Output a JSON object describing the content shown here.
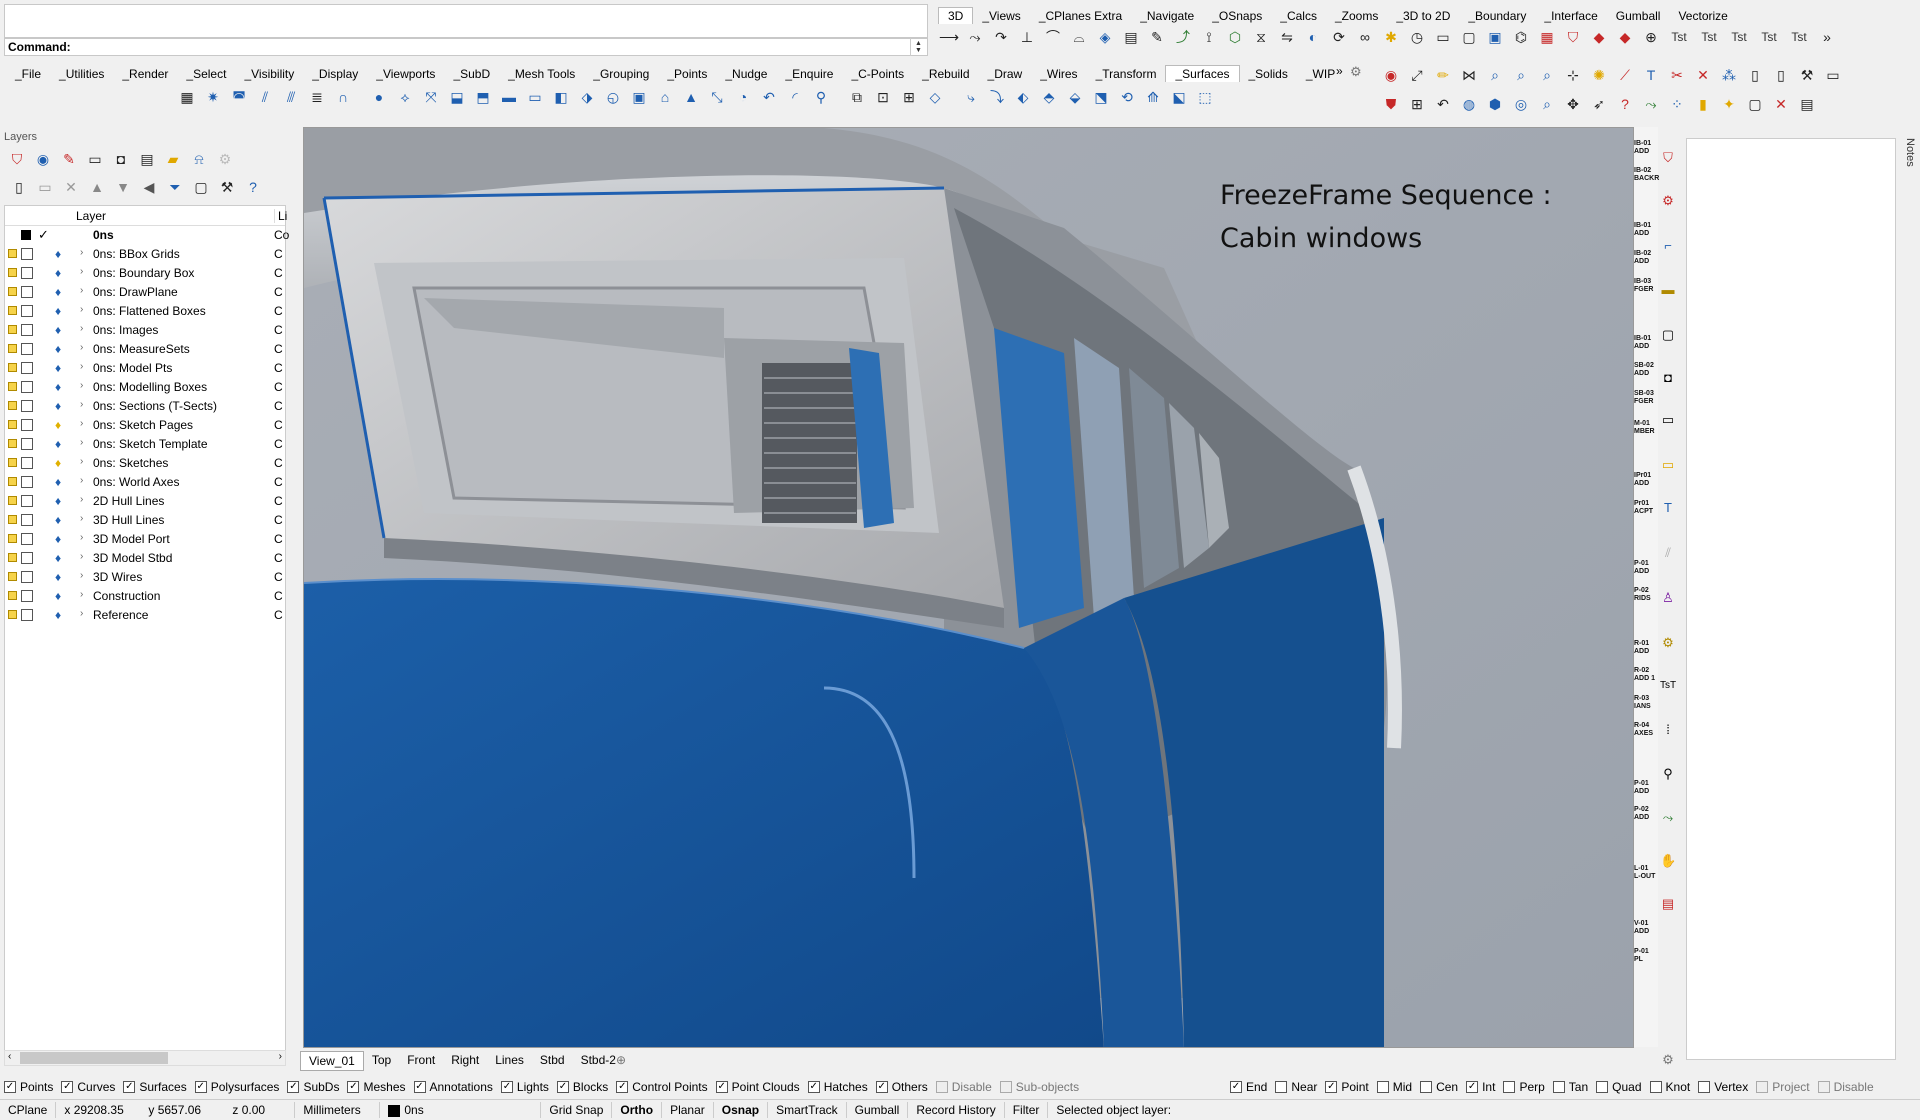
{
  "command": {
    "label": "Command:",
    "value": ""
  },
  "tabs_top": [
    "3D",
    "_Views",
    "_CPlanes Extra",
    "_Navigate",
    "_OSnaps",
    "_Calcs",
    "_Zooms",
    "_3D to 2D",
    "_Boundary",
    "_Interface",
    "Gumball",
    "Vectorize"
  ],
  "tabs_main": [
    "_File",
    "_Utilities",
    "_Render",
    "_Select",
    "_Visibility",
    "_Display",
    "_Viewports",
    "_SubD",
    "_Mesh Tools",
    "_Grouping",
    "_Points",
    "_Nudge",
    "_Enquire",
    "_C-Points",
    "_Rebuild",
    "_Draw",
    "_Wires",
    "_Transform",
    "_Surfaces",
    "_Solids",
    "_WIP"
  ],
  "tst_labels": [
    "Tst",
    "Tst",
    "Tst",
    "Tst",
    "Tst"
  ],
  "layers": {
    "title": "Layers",
    "col_layer": "Layer",
    "col_li": "Li",
    "current": "0ns",
    "rows": [
      {
        "name": "0ns: BBox Grids",
        "c": "C"
      },
      {
        "name": "0ns: Boundary Box",
        "c": "C"
      },
      {
        "name": "0ns: DrawPlane",
        "c": "C"
      },
      {
        "name": "0ns: Flattened Boxes",
        "c": "C"
      },
      {
        "name": "0ns: Images",
        "c": "C"
      },
      {
        "name": "0ns: MeasureSets",
        "c": "C"
      },
      {
        "name": "0ns: Model Pts",
        "c": "C"
      },
      {
        "name": "0ns: Modelling Boxes",
        "c": "C"
      },
      {
        "name": "0ns: Sections (T-Sects)",
        "c": "C"
      },
      {
        "name": "0ns: Sketch Pages",
        "c": "C"
      },
      {
        "name": "0ns: Sketch Template",
        "c": "C"
      },
      {
        "name": "0ns: Sketches",
        "c": "C"
      },
      {
        "name": "0ns: World Axes",
        "c": "C"
      },
      {
        "name": "2D Hull Lines",
        "c": "C"
      },
      {
        "name": "3D Hull Lines",
        "c": "C"
      },
      {
        "name": "3D Model Port",
        "c": "C"
      },
      {
        "name": "3D Model Stbd",
        "c": "C"
      },
      {
        "name": "3D Wires",
        "c": "C"
      },
      {
        "name": "Construction",
        "c": "C"
      },
      {
        "name": "Reference",
        "c": "C"
      }
    ]
  },
  "viewport": {
    "title_line1": "FreezeFrame Sequence :",
    "title_line2": "Cabin windows",
    "tabs": [
      "View_01",
      "Top",
      "Front",
      "Right",
      "Lines",
      "Stbd",
      "Stbd-2"
    ]
  },
  "right_labels": [
    "IB-01\nADD",
    "IB-02\nBACKR",
    "IB-01\nADD",
    "IB-02\nADD",
    "IB-03\nFGER",
    "IB-01\nADD",
    "SB-02\nADD",
    "SB-03\nFGER",
    "M-01\nMBER",
    "IPr01\nADD",
    "Pr01\nACPT",
    "P-01\nADD",
    "P-02\nRIDS",
    "R-01\nADD",
    "R-02\nADD 1",
    "R-03\nIANS",
    "R-04\nAXES",
    "P-01\nADD",
    "P-02\nADD",
    "L-01\nL-OUT",
    "V-01\nADD",
    "P-01\nPL"
  ],
  "notes_label": "Notes",
  "filters": [
    {
      "label": "Points",
      "on": true
    },
    {
      "label": "Curves",
      "on": true
    },
    {
      "label": "Surfaces",
      "on": true
    },
    {
      "label": "Polysurfaces",
      "on": true
    },
    {
      "label": "SubDs",
      "on": true
    },
    {
      "label": "Meshes",
      "on": true
    },
    {
      "label": "Annotations",
      "on": true
    },
    {
      "label": "Lights",
      "on": true
    },
    {
      "label": "Blocks",
      "on": true
    },
    {
      "label": "Control Points",
      "on": true
    },
    {
      "label": "Point Clouds",
      "on": true
    },
    {
      "label": "Hatches",
      "on": true
    },
    {
      "label": "Others",
      "on": true
    },
    {
      "label": "Disable",
      "on": false,
      "dis": true
    },
    {
      "label": "Sub-objects",
      "on": false,
      "dis": true
    }
  ],
  "osnaps": [
    {
      "label": "End",
      "on": true
    },
    {
      "label": "Near",
      "on": false
    },
    {
      "label": "Point",
      "on": true
    },
    {
      "label": "Mid",
      "on": false
    },
    {
      "label": "Cen",
      "on": false
    },
    {
      "label": "Int",
      "on": true
    },
    {
      "label": "Perp",
      "on": false
    },
    {
      "label": "Tan",
      "on": false
    },
    {
      "label": "Quad",
      "on": false
    },
    {
      "label": "Knot",
      "on": false
    },
    {
      "label": "Vertex",
      "on": false
    },
    {
      "label": "Project",
      "on": false,
      "dis": true
    },
    {
      "label": "Disable",
      "on": false,
      "dis": true
    }
  ],
  "status": {
    "cplane": "CPlane",
    "x": "x 29208.35",
    "y": "y 5657.06",
    "z": "z 0.00",
    "units": "Millimeters",
    "layer": "0ns",
    "grid_snap": "Grid Snap",
    "ortho": "Ortho",
    "planar": "Planar",
    "osnap": "Osnap",
    "smarttrack": "SmartTrack",
    "gumball": "Gumball",
    "record_history": "Record History",
    "filter": "Filter",
    "message": "Selected object layer:"
  }
}
